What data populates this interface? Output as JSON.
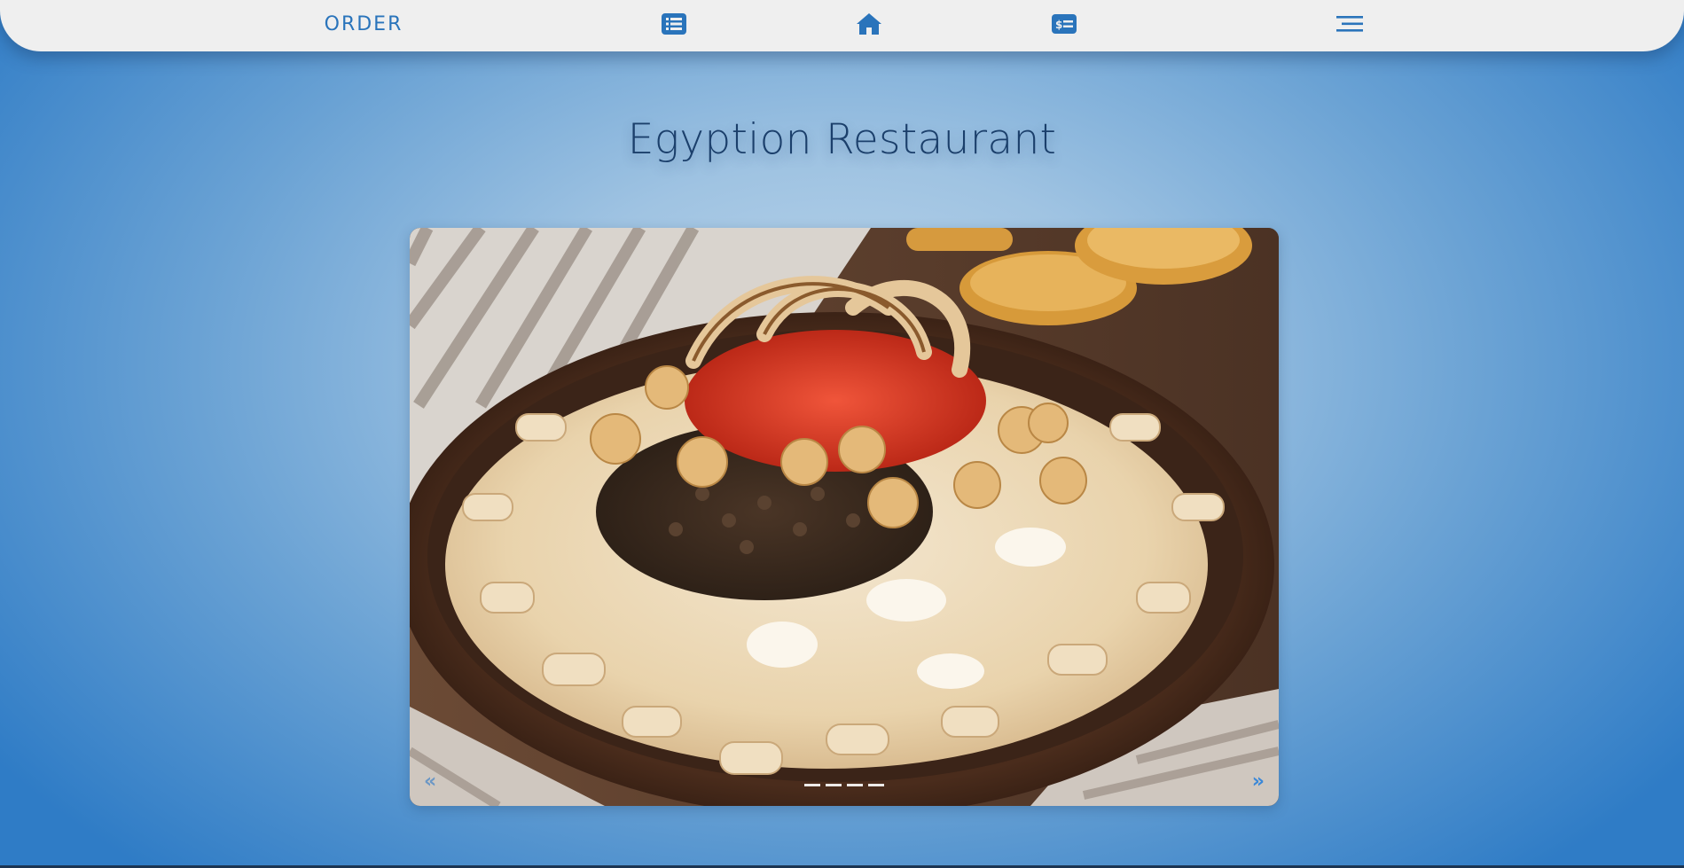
{
  "nav": {
    "order_label": "ORDER",
    "icons": [
      "list-icon",
      "home-icon",
      "bill-icon",
      "menu-icon"
    ],
    "accent_color": "#2a74bb"
  },
  "page": {
    "title": "Egyption Restaurant"
  },
  "carousel": {
    "prev_label": "«",
    "next_label": "»",
    "indicator_count": 4
  },
  "colors": {
    "navbar_bg": "#efefef",
    "title": "#1b3f6b",
    "background_edge": "#2f7cc6",
    "background_center": "#bdd6ea"
  }
}
